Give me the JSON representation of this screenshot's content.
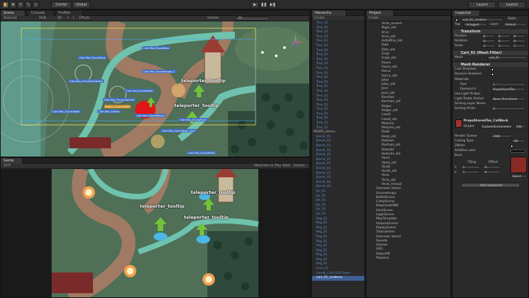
{
  "toolbar": {
    "pivot_label": "Center",
    "space_label": "Global",
    "layers_label": "Layers",
    "layout_label": "Layout"
  },
  "scene_panel": {
    "tabs": [
      "Scene",
      "Console",
      "Profiler"
    ],
    "shading_mode": "Textured",
    "render_mode": "RGB",
    "mode_2d": "2D",
    "effects_label": "Effects",
    "gizmos_label": "Gizmos",
    "search_placeholder": "All",
    "camera_labels": [
      "Cam.Pos_FocusNew",
      "Cam.Pos_FocusRock",
      "Cam.Pos_FocusBridge_2",
      "Cam.Pos_FocusPosCenter",
      "Cam.Pos_FocusBook",
      "Cam.Pos_FocusCamera",
      "Beach_CameraPos",
      "Cam.Pos_Shield",
      "Cam.Pos_ShieldMarks",
      "Cam.Pos_FocusTower",
      "Cam.Pos_FocusRiver",
      "Cam.Pos_FocusTown_End",
      "Cam.Pos_FocusBuild"
    ],
    "tooltips": [
      "teleporter_tooltip",
      "teleporter_tooltip"
    ]
  },
  "game_panel": {
    "tab": "Game",
    "aspect": "16:9",
    "maximize_label": "Maximize on Play",
    "stats_label": "Stats",
    "gizmos_label": "Gizmos",
    "tooltips": [
      "teleporter_tooltip",
      "teleporter_tooltip",
      "teleporter_tooltip"
    ]
  },
  "hierarchy": {
    "tab": "Hierarchy",
    "create_label": "Create",
    "rows": [
      "Tree_01",
      "Tree_01",
      "Tree_01",
      "Tree_01",
      "Tree_01",
      "Tree_01",
      "Tree_01",
      "Tree_01",
      "Tree_01",
      "Tree_01",
      "Tree_01",
      "Tree_01",
      "Tree_01",
      "Tree_01",
      "Tree_01",
      "Tree_01",
      "Tree_01",
      "Tree_01",
      "Tree_01",
      "Tree_01",
      "Tree_01",
      "Tree_01",
      "Tree_01",
      "Tree_01",
      "PROPS_others",
      "Barrel_01",
      "Barrel_01",
      "Barrel_01",
      "Barrel_01",
      "Barrel_01",
      "Barrel_01",
      "Barrel_01",
      "Barrel_01",
      "Barrel_01",
      "Barrel_01",
      "Barrel_01",
      "Barrel_01",
      "Jar_01",
      "Jar_01",
      "Jar_01",
      "Jar_01",
      "Jar_01",
      "Jar_01",
      "Peg_01",
      "Peg_01",
      "Peg_01",
      "Peg_01",
      "Peg_01",
      "Peg_01",
      "Peg_01",
      "Peg_01",
      "Peg_01",
      "Peg_01",
      "Peg_01",
      "Cart_01",
      "Forest_Cart_01(Clone)",
      "cart_01_renderer"
    ]
  },
  "project": {
    "tab": "Project",
    "create_label": "Create",
    "rows": [
      "Viras_renaud",
      "Algar_old",
      "Arun",
      "Arun_old",
      "AsduMne_old",
      "Dalo",
      "Dalo_old",
      "Erajo",
      "Erajo_old",
      "Faeon",
      "Faeon_old",
      "Harus",
      "Harus_old",
      "Jatar",
      "Jatar_old",
      "Jesri",
      "Jesri_old",
      "Karchan",
      "Karchan_old",
      "Kelgor",
      "Kelgor_old",
      "Lisadi",
      "Lisadi_old",
      "Melyma",
      "Melyma_old",
      "Ralat",
      "Ralat_old",
      "Rasham",
      "Rasham_old",
      "Rolande",
      "Rolande_old",
      "Vanis",
      "Vanis_old",
      "Vindil",
      "Vindil_old",
      "Viras",
      "Viras_old",
      "Viras_renaud",
      "Unknown Island",
      "Unusedmaps",
      "BattleScene",
      "CampScene",
      "DownloadOBB",
      "IntroScene",
      "LoginScene",
      "MapTemplate",
      "OutpostScene",
      "ReplayScene",
      "TutorialIntro",
      "Unknown Island",
      "Sounds",
      "Gizmos",
      "GPG",
      "Helpshift",
      "PlayLine"
    ]
  },
  "inspector": {
    "tab": "Inspector",
    "static_label": "Static",
    "object_name": "cart_01_renderer",
    "tag_label": "Tag",
    "tag_value": "Untagged",
    "layer_label": "Layer",
    "layer_value": "Default",
    "transform": {
      "header": "Transform",
      "position_label": "Position",
      "rotation_label": "Rotation",
      "scale_label": "Scale",
      "pos": [
        "0",
        "0",
        "0"
      ],
      "rot": [
        "0",
        "0",
        "0"
      ],
      "scale": [
        "1",
        "1",
        "1"
      ]
    },
    "mesh_filter": {
      "header": "Cart_01 (Mesh Filter)",
      "mesh_label": "Mesh",
      "mesh_value": "cart_01"
    },
    "mesh_renderer": {
      "header": "Mesh Renderer",
      "cast_shadows": "Cast Shadows",
      "receive_shadows": "Receive Shadows",
      "materials": "Materials",
      "size_label": "Size",
      "size_value": "1",
      "element_label": "Element 0",
      "element_value": "PropsSharedTex",
      "use_light_probes": "Use Light Probes",
      "light_probe_anchor": "Light Probe Anchor",
      "anchor_value": "None (Transform)",
      "sorting_layer": "Sorting Layer Name",
      "sorting_order": "Sorting Order",
      "sorting_order_value": "0"
    },
    "material": {
      "name": "PropsSharedTex_CullBack",
      "shader_label": "Shader",
      "shader_value": "Custom/Environment",
      "edit_label": "Edit",
      "render_queue": "Render Queue",
      "render_queue_value": "2000",
      "culling_type": "Culling Type",
      "culling_value": "Off",
      "zwrite": "ZWrite",
      "additive": "Additive color",
      "base": "Base",
      "tiling_label": "Tiling",
      "offset_label": "Offset",
      "tiling_x": "1",
      "tiling_y": "1",
      "offset_x": "0",
      "offset_y": "0",
      "select_label": "Select"
    },
    "add_component": "Add Component"
  },
  "colors": {
    "accent": "#3e6ec7",
    "grass": "#4f6f57",
    "path": "#6fc2ad",
    "road": "#a07a63"
  }
}
